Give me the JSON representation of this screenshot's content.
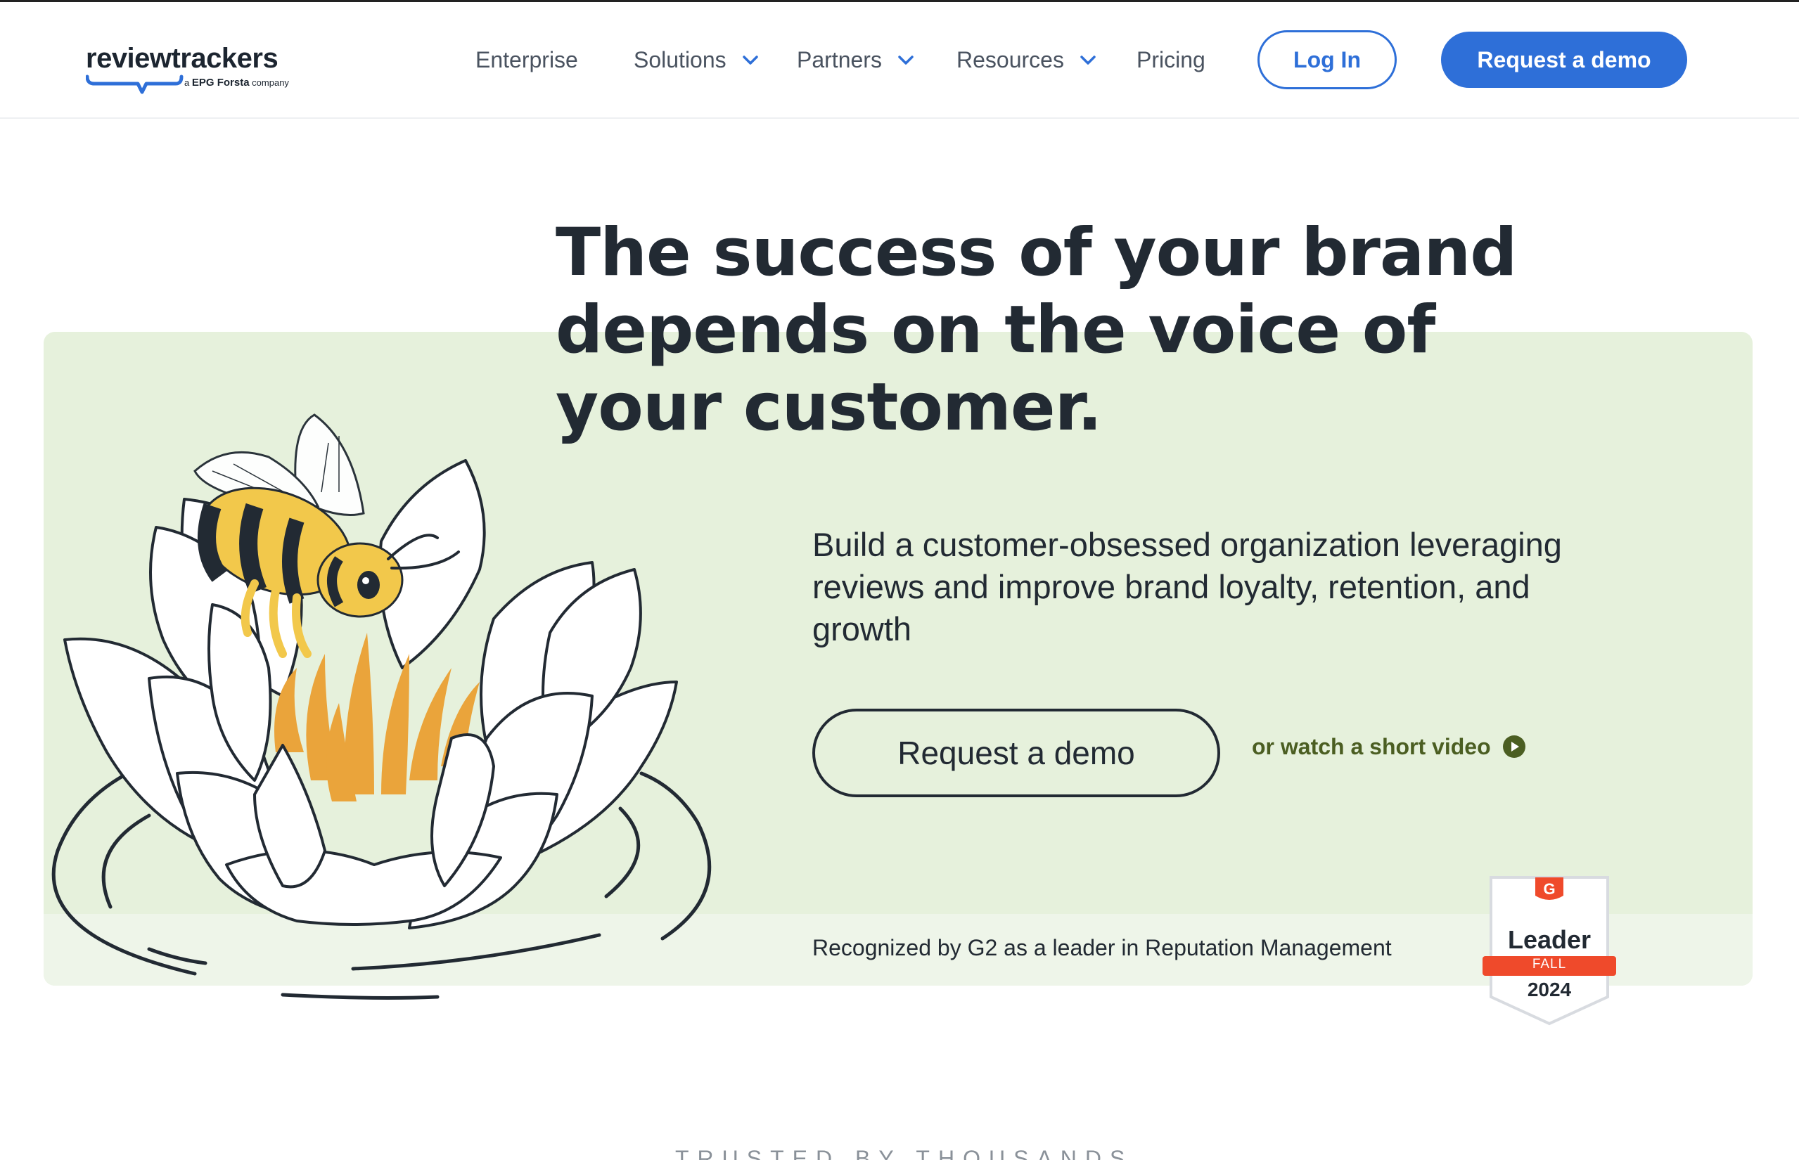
{
  "brand": {
    "name": "reviewtrackers",
    "sub_prefix": "a",
    "sub_company": "EPG Forsta",
    "sub_suffix": "company"
  },
  "nav": {
    "items": [
      {
        "label": "Enterprise",
        "has_dropdown": false
      },
      {
        "label": "Solutions",
        "has_dropdown": true
      },
      {
        "label": "Partners",
        "has_dropdown": true
      },
      {
        "label": "Resources",
        "has_dropdown": true
      },
      {
        "label": "Pricing",
        "has_dropdown": false
      }
    ],
    "login_label": "Log In",
    "demo_label": "Request a demo"
  },
  "hero": {
    "headline": "The success of your brand depends on the voice of your customer.",
    "subtext": "Build a customer-obsessed organization leveraging reviews and improve brand loyalty, retention, and growth",
    "cta_label": "Request a demo",
    "video_link": "or watch a short video",
    "recognition": "Recognized by G2 as a leader in Reputation Management"
  },
  "g2_badge": {
    "title": "Leader",
    "season": "FALL",
    "year": "2024"
  },
  "trusted_heading": "TRUSTED BY THOUSANDS",
  "colors": {
    "accent_blue": "#2e6fd8",
    "hero_bg": "#e6f1dc",
    "text_dark": "#222a33",
    "video_link": "#4b5e22",
    "g2_red": "#ef4a2b",
    "bee_yellow": "#f2c84b",
    "flame_orange": "#eaa43b"
  }
}
